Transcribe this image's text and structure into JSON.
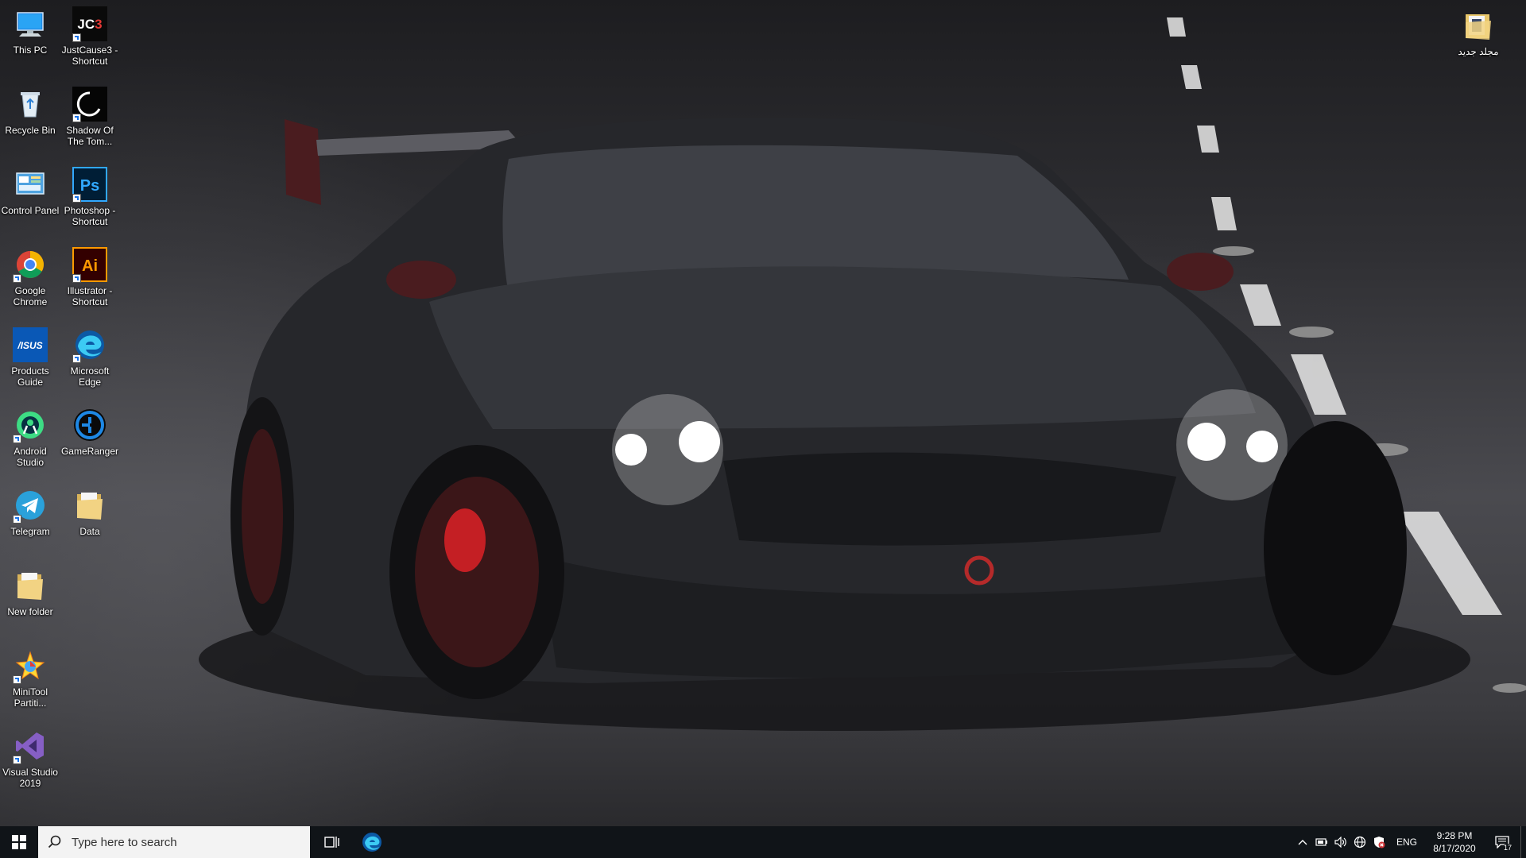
{
  "desktop": {
    "icons_left": [
      {
        "name": "this-pc",
        "label": "This PC",
        "icon": "monitor-icon",
        "shortcut": false
      },
      {
        "name": "justcause3-shortcut",
        "label": "JustCause3 - Shortcut",
        "icon": "jc3-icon",
        "shortcut": true,
        "glyph": "JC3"
      },
      {
        "name": "recycle-bin",
        "label": "Recycle Bin",
        "icon": "recycle-bin-icon",
        "shortcut": false
      },
      {
        "name": "shadow-of-the-tomb-raider",
        "label": "Shadow Of The Tom...",
        "icon": "tomb-raider-icon",
        "shortcut": true
      },
      {
        "name": "control-panel",
        "label": "Control Panel",
        "icon": "control-panel-icon",
        "shortcut": false
      },
      {
        "name": "photoshop-shortcut",
        "label": "Photoshop - Shortcut",
        "icon": "photoshop-icon",
        "shortcut": true,
        "glyph": "Ps"
      },
      {
        "name": "google-chrome",
        "label": "Google Chrome",
        "icon": "chrome-icon",
        "shortcut": true
      },
      {
        "name": "illustrator-shortcut",
        "label": "Illustrator - Shortcut",
        "icon": "illustrator-icon",
        "shortcut": true,
        "glyph": "Ai"
      },
      {
        "name": "products-guide",
        "label": "Products Guide",
        "icon": "asus-icon",
        "shortcut": false,
        "glyph": "/ISUS"
      },
      {
        "name": "microsoft-edge",
        "label": "Microsoft Edge",
        "icon": "edge-icon",
        "shortcut": true
      },
      {
        "name": "android-studio",
        "label": "Android Studio",
        "icon": "android-studio-icon",
        "shortcut": true
      },
      {
        "name": "gameranger",
        "label": "GameRanger",
        "icon": "gameranger-icon",
        "shortcut": false
      },
      {
        "name": "telegram",
        "label": "Telegram",
        "icon": "telegram-icon",
        "shortcut": true
      },
      {
        "name": "data-folder",
        "label": "Data",
        "icon": "folder-icon",
        "shortcut": false
      },
      {
        "name": "new-folder",
        "label": "New folder",
        "icon": "folder-icon",
        "shortcut": false
      },
      {
        "name": "minitool-partition",
        "label": "MiniTool Partiti...",
        "icon": "minitool-icon",
        "shortcut": true
      },
      {
        "name": "visual-studio-2019",
        "label": "Visual Studio 2019",
        "icon": "visual-studio-icon",
        "shortcut": true
      }
    ],
    "icon_right": {
      "name": "arabic-new-folder",
      "label": "مجلد جديد",
      "icon": "folder-icon",
      "shortcut": false
    }
  },
  "taskbar": {
    "search_placeholder": "Type here to search",
    "language": "ENG",
    "time": "9:28 PM",
    "date": "8/17/2020",
    "notification_count": "17",
    "accent": "#0078d7",
    "background": "#101418"
  }
}
